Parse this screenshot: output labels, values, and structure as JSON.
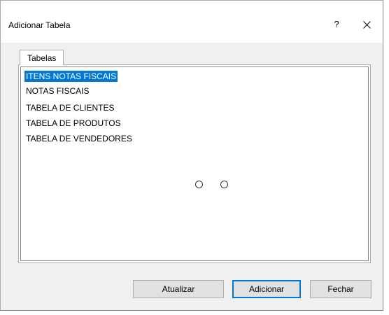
{
  "dialog": {
    "title": "Adicionar Tabela",
    "help_label": "?"
  },
  "tabs": [
    {
      "label": "Tabelas",
      "active": true
    }
  ],
  "list": {
    "items": [
      {
        "label": "ITENS NOTAS FISCAIS",
        "selected": true
      },
      {
        "label": "NOTAS FISCAIS",
        "selected": false
      },
      {
        "label": "TABELA DE CLIENTES",
        "selected": false
      },
      {
        "label": "TABELA DE PRODUTOS",
        "selected": false
      },
      {
        "label": "TABELA DE VENDEDORES",
        "selected": false
      }
    ]
  },
  "buttons": {
    "refresh_label": "Atualizar",
    "add_label": "Adicionar",
    "close_label": "Fechar"
  },
  "icons": {
    "close": "close-icon",
    "help": "help-icon",
    "busy": "busy-indicator-icon"
  },
  "colors": {
    "selection": "#0078d7",
    "window_bg": "#f0f0f0",
    "button_bg": "#e1e1e1"
  }
}
